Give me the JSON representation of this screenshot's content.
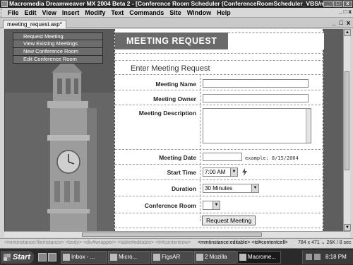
{
  "window": {
    "title": "Macromedia Dreamweaver MX 2004 Beta 2 - [Conference Room Scheduler (ConferenceRoomScheduler_VBS/m...",
    "controls": [
      "_",
      "□",
      "x"
    ]
  },
  "menubar": {
    "items": [
      "File",
      "Edit",
      "View",
      "Insert",
      "Modify",
      "Text",
      "Commands",
      "Site",
      "Window",
      "Help"
    ],
    "mdi_controls": [
      "_",
      "□",
      "x"
    ]
  },
  "document": {
    "tab_label": "meeting_request.asp*",
    "controls": [
      "_",
      "□",
      "x"
    ]
  },
  "page": {
    "nav_items": [
      "Request Meeting",
      "View Existing Meetings",
      "New Conference Room",
      "Edit Conference Room"
    ],
    "banner_title": "MEETING REQUEST",
    "form_heading": "Enter Meeting Request",
    "fields": {
      "meeting_name": "Meeting Name",
      "meeting_owner": "Meeting Owner",
      "meeting_description": "Meeting Description",
      "meeting_date": "Meeting Date",
      "date_hint": "example: 8/15/2004",
      "start_time": "Start Time",
      "start_time_value": "7:00 AM",
      "duration": "Duration",
      "duration_value": "30 Minutes",
      "conference_room": "Conference Room",
      "conference_room_value": ""
    },
    "submit_label": "Request Meeting"
  },
  "status": {
    "tags_dim": "<mmtinstance:fileinstance> <body> <div#wrapper> <table#editable> <tr#contentrow>",
    "tags_active": "<mmtinstance:editable> <td#contentcell>",
    "size": "784 x 471 ⌄ 26K / 8 sec"
  },
  "taskbar": {
    "start_label": "Start",
    "tasks": [
      "Inbox - ...",
      "Micro...",
      "FigsAR",
      "2 Mozilla",
      "Macrome..."
    ],
    "clock": "8:18 PM"
  }
}
